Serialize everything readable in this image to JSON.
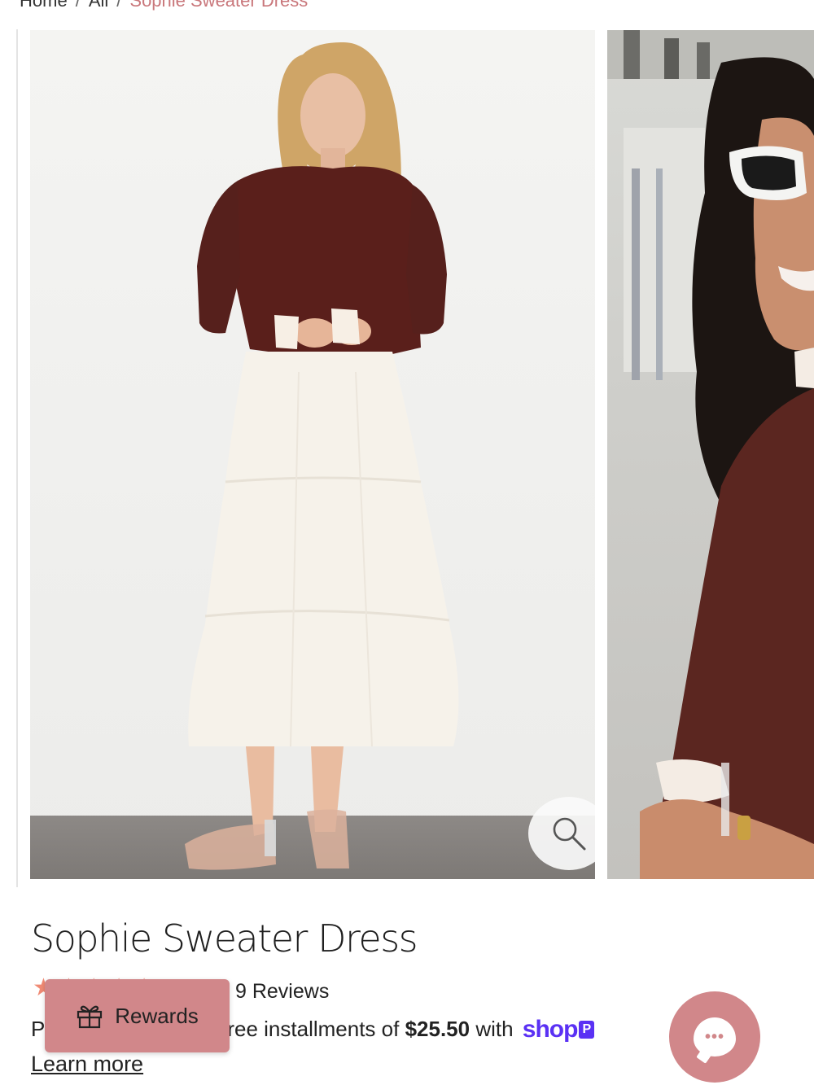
{
  "breadcrumb": {
    "items": [
      "Home",
      "All",
      "Sophie Sweater Dress"
    ],
    "separator": "/"
  },
  "gallery": {
    "main_image": "model in brown sweater and white tiered skirt",
    "second_image": "model in brown sweater with sunglasses",
    "zoom_icon": "magnifier-icon"
  },
  "product": {
    "title": "Sophie Sweater Dress",
    "rating_stars": "★★★★★",
    "rating_value": 5,
    "reviews_label": "9 Reviews"
  },
  "payment": {
    "prefix": "P",
    "text_middle": "ree installments of ",
    "amount": "$25.50",
    "text_suffix": " with ",
    "shop_logo": "shop",
    "shop_badge": "P"
  },
  "learn_more_label": "Learn more",
  "rewards": {
    "label": "Rewards",
    "icon": "gift-icon"
  },
  "chat": {
    "icon": "chat-bubble-icon",
    "dots": "•••"
  },
  "colors": {
    "accent": "#d1878a",
    "star": "#f08a74",
    "shop_purple": "#5a31f4",
    "breadcrumb_current": "#c9777b"
  }
}
